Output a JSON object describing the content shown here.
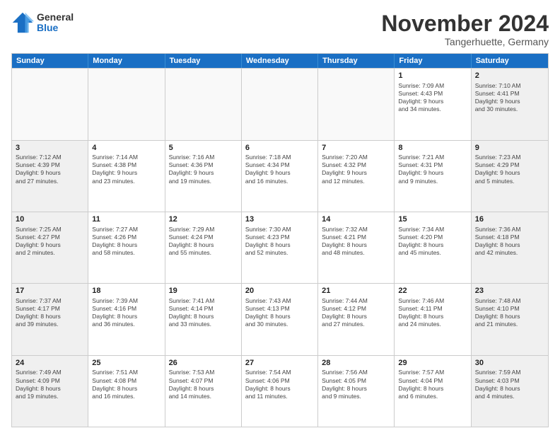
{
  "logo": {
    "general": "General",
    "blue": "Blue"
  },
  "title": "November 2024",
  "location": "Tangerhuette, Germany",
  "header_days": [
    "Sunday",
    "Monday",
    "Tuesday",
    "Wednesday",
    "Thursday",
    "Friday",
    "Saturday"
  ],
  "rows": [
    [
      {
        "day": "",
        "info": ""
      },
      {
        "day": "",
        "info": ""
      },
      {
        "day": "",
        "info": ""
      },
      {
        "day": "",
        "info": ""
      },
      {
        "day": "",
        "info": ""
      },
      {
        "day": "1",
        "info": "Sunrise: 7:09 AM\nSunset: 4:43 PM\nDaylight: 9 hours\nand 34 minutes."
      },
      {
        "day": "2",
        "info": "Sunrise: 7:10 AM\nSunset: 4:41 PM\nDaylight: 9 hours\nand 30 minutes."
      }
    ],
    [
      {
        "day": "3",
        "info": "Sunrise: 7:12 AM\nSunset: 4:39 PM\nDaylight: 9 hours\nand 27 minutes."
      },
      {
        "day": "4",
        "info": "Sunrise: 7:14 AM\nSunset: 4:38 PM\nDaylight: 9 hours\nand 23 minutes."
      },
      {
        "day": "5",
        "info": "Sunrise: 7:16 AM\nSunset: 4:36 PM\nDaylight: 9 hours\nand 19 minutes."
      },
      {
        "day": "6",
        "info": "Sunrise: 7:18 AM\nSunset: 4:34 PM\nDaylight: 9 hours\nand 16 minutes."
      },
      {
        "day": "7",
        "info": "Sunrise: 7:20 AM\nSunset: 4:32 PM\nDaylight: 9 hours\nand 12 minutes."
      },
      {
        "day": "8",
        "info": "Sunrise: 7:21 AM\nSunset: 4:31 PM\nDaylight: 9 hours\nand 9 minutes."
      },
      {
        "day": "9",
        "info": "Sunrise: 7:23 AM\nSunset: 4:29 PM\nDaylight: 9 hours\nand 5 minutes."
      }
    ],
    [
      {
        "day": "10",
        "info": "Sunrise: 7:25 AM\nSunset: 4:27 PM\nDaylight: 9 hours\nand 2 minutes."
      },
      {
        "day": "11",
        "info": "Sunrise: 7:27 AM\nSunset: 4:26 PM\nDaylight: 8 hours\nand 58 minutes."
      },
      {
        "day": "12",
        "info": "Sunrise: 7:29 AM\nSunset: 4:24 PM\nDaylight: 8 hours\nand 55 minutes."
      },
      {
        "day": "13",
        "info": "Sunrise: 7:30 AM\nSunset: 4:23 PM\nDaylight: 8 hours\nand 52 minutes."
      },
      {
        "day": "14",
        "info": "Sunrise: 7:32 AM\nSunset: 4:21 PM\nDaylight: 8 hours\nand 48 minutes."
      },
      {
        "day": "15",
        "info": "Sunrise: 7:34 AM\nSunset: 4:20 PM\nDaylight: 8 hours\nand 45 minutes."
      },
      {
        "day": "16",
        "info": "Sunrise: 7:36 AM\nSunset: 4:18 PM\nDaylight: 8 hours\nand 42 minutes."
      }
    ],
    [
      {
        "day": "17",
        "info": "Sunrise: 7:37 AM\nSunset: 4:17 PM\nDaylight: 8 hours\nand 39 minutes."
      },
      {
        "day": "18",
        "info": "Sunrise: 7:39 AM\nSunset: 4:16 PM\nDaylight: 8 hours\nand 36 minutes."
      },
      {
        "day": "19",
        "info": "Sunrise: 7:41 AM\nSunset: 4:14 PM\nDaylight: 8 hours\nand 33 minutes."
      },
      {
        "day": "20",
        "info": "Sunrise: 7:43 AM\nSunset: 4:13 PM\nDaylight: 8 hours\nand 30 minutes."
      },
      {
        "day": "21",
        "info": "Sunrise: 7:44 AM\nSunset: 4:12 PM\nDaylight: 8 hours\nand 27 minutes."
      },
      {
        "day": "22",
        "info": "Sunrise: 7:46 AM\nSunset: 4:11 PM\nDaylight: 8 hours\nand 24 minutes."
      },
      {
        "day": "23",
        "info": "Sunrise: 7:48 AM\nSunset: 4:10 PM\nDaylight: 8 hours\nand 21 minutes."
      }
    ],
    [
      {
        "day": "24",
        "info": "Sunrise: 7:49 AM\nSunset: 4:09 PM\nDaylight: 8 hours\nand 19 minutes."
      },
      {
        "day": "25",
        "info": "Sunrise: 7:51 AM\nSunset: 4:08 PM\nDaylight: 8 hours\nand 16 minutes."
      },
      {
        "day": "26",
        "info": "Sunrise: 7:53 AM\nSunset: 4:07 PM\nDaylight: 8 hours\nand 14 minutes."
      },
      {
        "day": "27",
        "info": "Sunrise: 7:54 AM\nSunset: 4:06 PM\nDaylight: 8 hours\nand 11 minutes."
      },
      {
        "day": "28",
        "info": "Sunrise: 7:56 AM\nSunset: 4:05 PM\nDaylight: 8 hours\nand 9 minutes."
      },
      {
        "day": "29",
        "info": "Sunrise: 7:57 AM\nSunset: 4:04 PM\nDaylight: 8 hours\nand 6 minutes."
      },
      {
        "day": "30",
        "info": "Sunrise: 7:59 AM\nSunset: 4:03 PM\nDaylight: 8 hours\nand 4 minutes."
      }
    ]
  ]
}
